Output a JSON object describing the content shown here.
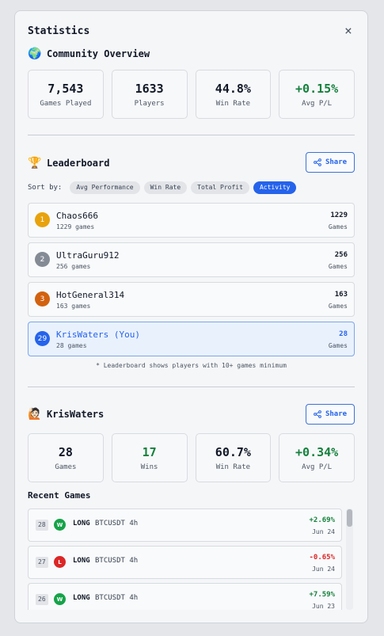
{
  "modal": {
    "title": "Statistics",
    "close_icon": "×"
  },
  "community": {
    "emoji": "🌍",
    "title": "Community Overview",
    "stats": [
      {
        "value": "7,543",
        "label": "Games Played",
        "positive": false
      },
      {
        "value": "1633",
        "label": "Players",
        "positive": false
      },
      {
        "value": "44.8%",
        "label": "Win Rate",
        "positive": false
      },
      {
        "value": "+0.15%",
        "label": "Avg P/L",
        "positive": true
      }
    ]
  },
  "leaderboard": {
    "emoji": "🏆",
    "title": "Leaderboard",
    "share_label": "Share",
    "sort_label": "Sort by:",
    "sort_options": [
      "Avg Performance",
      "Win Rate",
      "Total Profit",
      "Activity"
    ],
    "active_sort": "Activity",
    "entries": [
      {
        "rank": "1",
        "name": "Chaos666",
        "games": "1229 games",
        "value": "1229",
        "unit": "Games",
        "rank_color": "#e8a20c",
        "is_me": false
      },
      {
        "rank": "2",
        "name": "UltraGuru912",
        "games": "256 games",
        "value": "256",
        "unit": "Games",
        "rank_color": "#858b95",
        "is_me": false
      },
      {
        "rank": "3",
        "name": "HotGeneral314",
        "games": "163 games",
        "value": "163",
        "unit": "Games",
        "rank_color": "#d2620f",
        "is_me": false
      },
      {
        "rank": "29",
        "name": "KrisWaters (You)",
        "games": "28 games",
        "value": "28",
        "unit": "Games",
        "rank_color": "#2563eb",
        "is_me": true
      }
    ],
    "note": "* Leaderboard shows players with 10+ games minimum"
  },
  "user": {
    "emoji": "🙋🏻",
    "title": "KrisWaters",
    "share_label": "Share",
    "stats": [
      {
        "value": "28",
        "label": "Games",
        "positive": false
      },
      {
        "value": "17",
        "label": "Wins",
        "positive": true
      },
      {
        "value": "60.7%",
        "label": "Win Rate",
        "positive": false
      },
      {
        "value": "+0.34%",
        "label": "Avg P/L",
        "positive": true
      }
    ]
  },
  "recent_games": {
    "title": "Recent Games",
    "items": [
      {
        "num": "28",
        "result": "W",
        "side": "LONG",
        "pair": "BTCUSDT 4h",
        "pnl": "+2.69%",
        "date": "Jun 24"
      },
      {
        "num": "27",
        "result": "L",
        "side": "LONG",
        "pair": "BTCUSDT 4h",
        "pnl": "-0.65%",
        "date": "Jun 24"
      },
      {
        "num": "26",
        "result": "W",
        "side": "LONG",
        "pair": "BTCUSDT 4h",
        "pnl": "+7.59%",
        "date": "Jun 23"
      }
    ]
  },
  "colors": {
    "accent": "#2563eb",
    "win": "#16a34a",
    "loss": "#dc2626",
    "positive_text": "#15803d",
    "negative_text": "#dc2626"
  },
  "icons": {
    "close": "close-icon",
    "share": "share-icon"
  }
}
